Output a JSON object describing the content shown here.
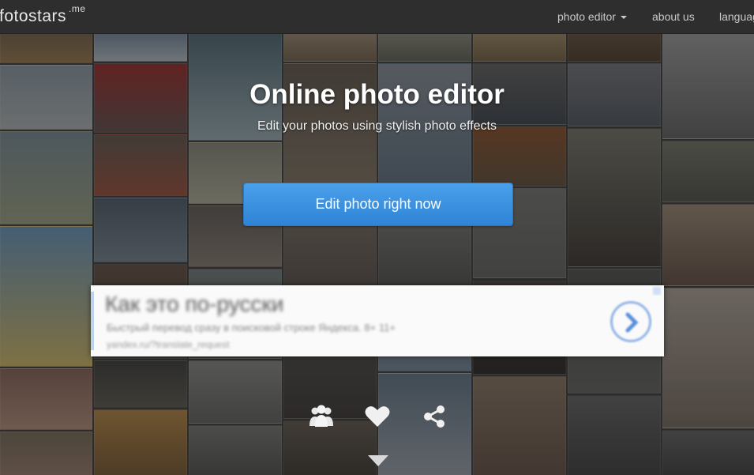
{
  "navbar": {
    "brand": "fotostars",
    "brand_suffix": ".me",
    "items": [
      {
        "label": "photo editor",
        "dropdown": true
      },
      {
        "label": "about us"
      },
      {
        "label": "languag"
      }
    ]
  },
  "hero": {
    "title": "Online photo editor",
    "subtitle": "Edit your photos using stylish photo effects",
    "cta_label": "Edit photo right now"
  },
  "ad": {
    "title": "Как это по-русски",
    "line1": "Быстрый перевод сразу в поисковой строке Яндекса. 8+ 11+",
    "line2": "yandex.ru/?translate_request"
  },
  "bottom_icons": [
    "users-icon",
    "heart-icon",
    "share-icon"
  ],
  "colors": {
    "navbar": "#2e2e2e",
    "cta": "#3b8fe0",
    "text": "#ffffff"
  }
}
